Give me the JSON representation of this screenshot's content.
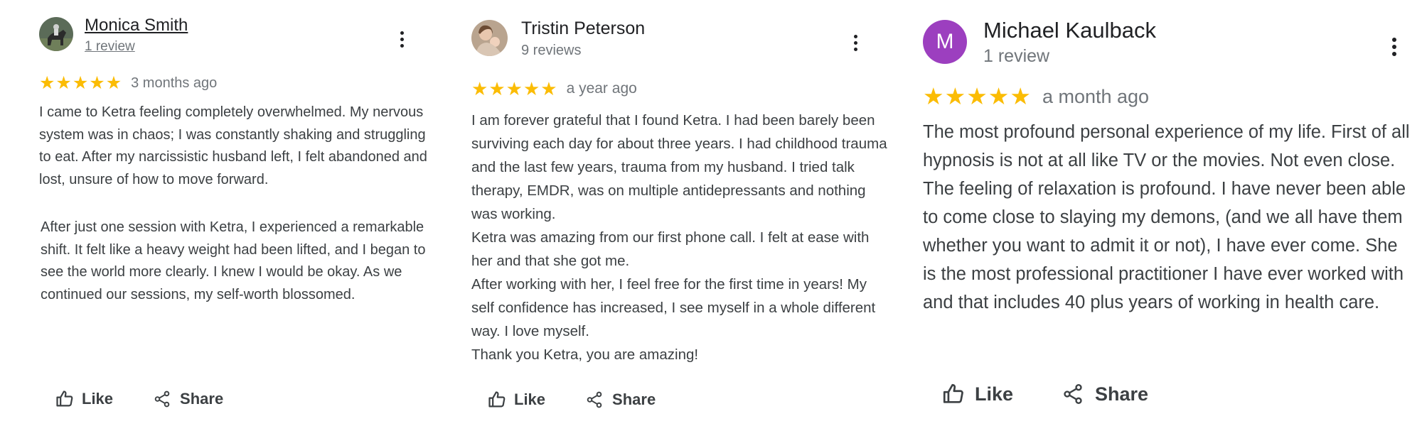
{
  "reviews": [
    {
      "name": "Monica Smith",
      "review_count": "1 review",
      "rating": 5,
      "time_ago": "3 months ago",
      "paragraphs": [
        "I came to Ketra feeling completely overwhelmed. My nervous system was in chaos; I was constantly shaking and struggling to eat. After my narcissistic husband left, I felt abandoned and lost, unsure of how to move forward.",
        "After just one session with Ketra, I experienced a remarkable shift. It felt like a heavy weight had been lifted, and I began to see the world more clearly. I knew I would be okay. As we continued our sessions, my self-worth blossomed."
      ],
      "like_label": "Like",
      "share_label": "Share"
    },
    {
      "name": "Tristin Peterson",
      "review_count": "9 reviews",
      "rating": 5,
      "time_ago": "a year ago",
      "paragraphs": [
        "I am forever grateful that I found Ketra. I had been barely been surviving each day for about three years. I had childhood trauma and the last few years, trauma from my husband. I tried talk therapy, EMDR, was on multiple antidepressants and nothing was working.",
        "Ketra was amazing from our first phone call. I felt at ease with her and that she got me.",
        "After working with her, I feel free for the first time in years! My self confidence has increased, I see myself in a whole different way. I love myself.",
        "Thank you Ketra, you are amazing!"
      ],
      "like_label": "Like",
      "share_label": "Share"
    },
    {
      "name": "Michael Kaulback",
      "review_count": "1 review",
      "avatar_letter": "M",
      "avatar_color": "#9c3fbf",
      "rating": 5,
      "time_ago": "a month ago",
      "paragraphs": [
        "The most profound personal experience of my life. First of all hypnosis is not at all like TV or the movies. Not even close. The feeling of relaxation is profound. I have never been able to come close to slaying my demons, (and we all have them whether you want to admit it or not), I have ever come. She is the most professional practitioner I have ever worked with and that includes 40 plus years of working in health care."
      ],
      "like_label": "Like",
      "share_label": "Share"
    }
  ],
  "colors": {
    "star": "#fbbc04",
    "name": "#202124",
    "muted": "#70757a",
    "text": "#3c4043"
  },
  "icons": {
    "star": "star-icon",
    "more": "more-vert-icon",
    "like": "thumb-up-icon",
    "share": "share-icon"
  }
}
